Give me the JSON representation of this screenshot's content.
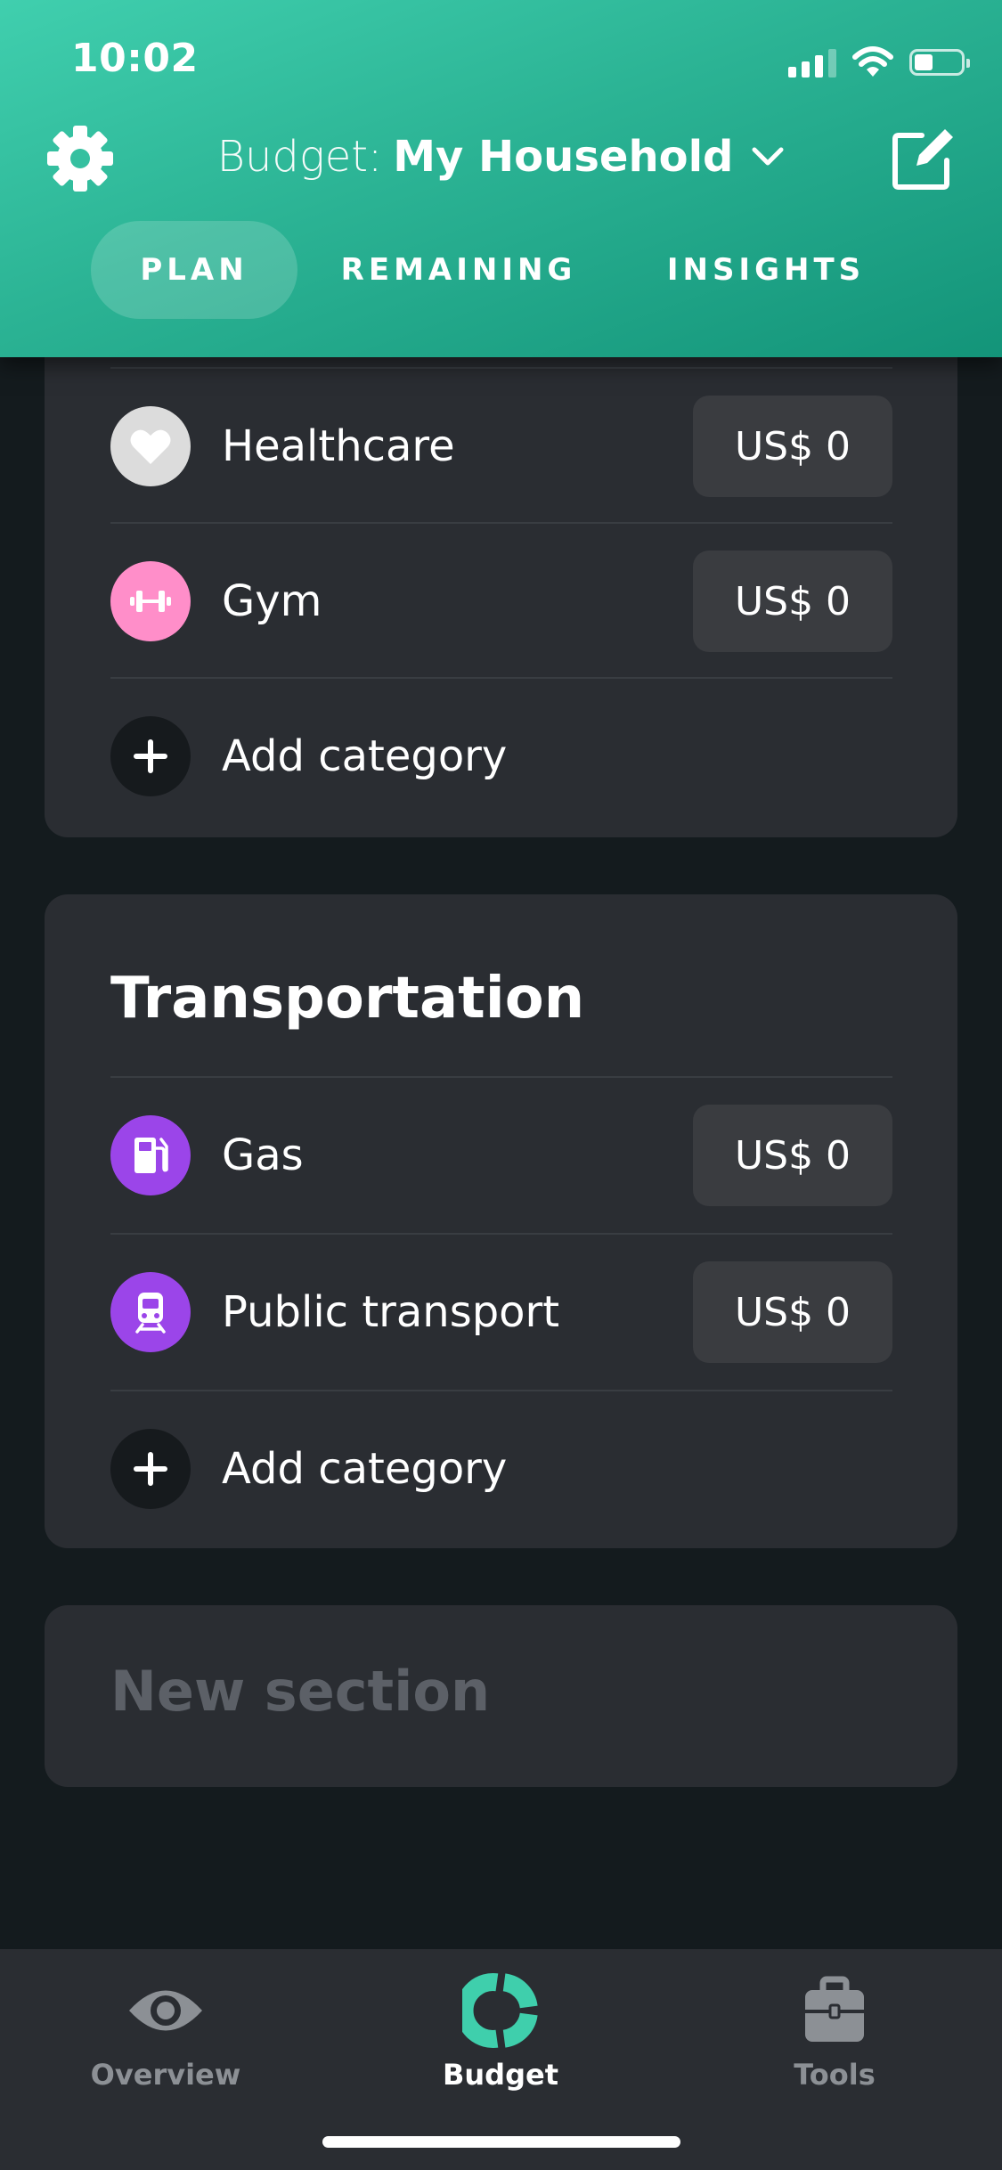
{
  "status_bar": {
    "time": "10:02",
    "battery_level": 0.4
  },
  "header": {
    "budget_prefix": "Budget:",
    "budget_name": "My Household",
    "tabs": [
      {
        "label": "PLAN",
        "active": true
      },
      {
        "label": "REMAINING",
        "active": false
      },
      {
        "label": "INSIGHTS",
        "active": false
      }
    ]
  },
  "sections": [
    {
      "title": "",
      "categories": [
        {
          "name": "Healthcare",
          "amount": "US$ 0",
          "icon": "heart-icon",
          "icon_bg": "#dcdcdc"
        },
        {
          "name": "Gym",
          "amount": "US$ 0",
          "icon": "dumbbell-icon",
          "icon_bg": "#ff8ec9"
        }
      ],
      "add_label": "Add category"
    },
    {
      "title": "Transportation",
      "categories": [
        {
          "name": "Gas",
          "amount": "US$ 0",
          "icon": "gas-pump-icon",
          "icon_bg": "#9b45e9"
        },
        {
          "name": "Public transport",
          "amount": "US$ 0",
          "icon": "train-icon",
          "icon_bg": "#9b45e9"
        }
      ],
      "add_label": "Add category"
    }
  ],
  "new_section": {
    "placeholder": "New section"
  },
  "bottom_nav": {
    "items": [
      {
        "label": "Overview",
        "icon": "eye-icon",
        "active": false
      },
      {
        "label": "Budget",
        "icon": "donut-chart-icon",
        "active": true
      },
      {
        "label": "Tools",
        "icon": "briefcase-icon",
        "active": false
      }
    ]
  },
  "colors": {
    "accent": "#2bb394",
    "background": "#141b1e",
    "card": "#2a2d32",
    "inactive_nav": "#8c9095"
  }
}
